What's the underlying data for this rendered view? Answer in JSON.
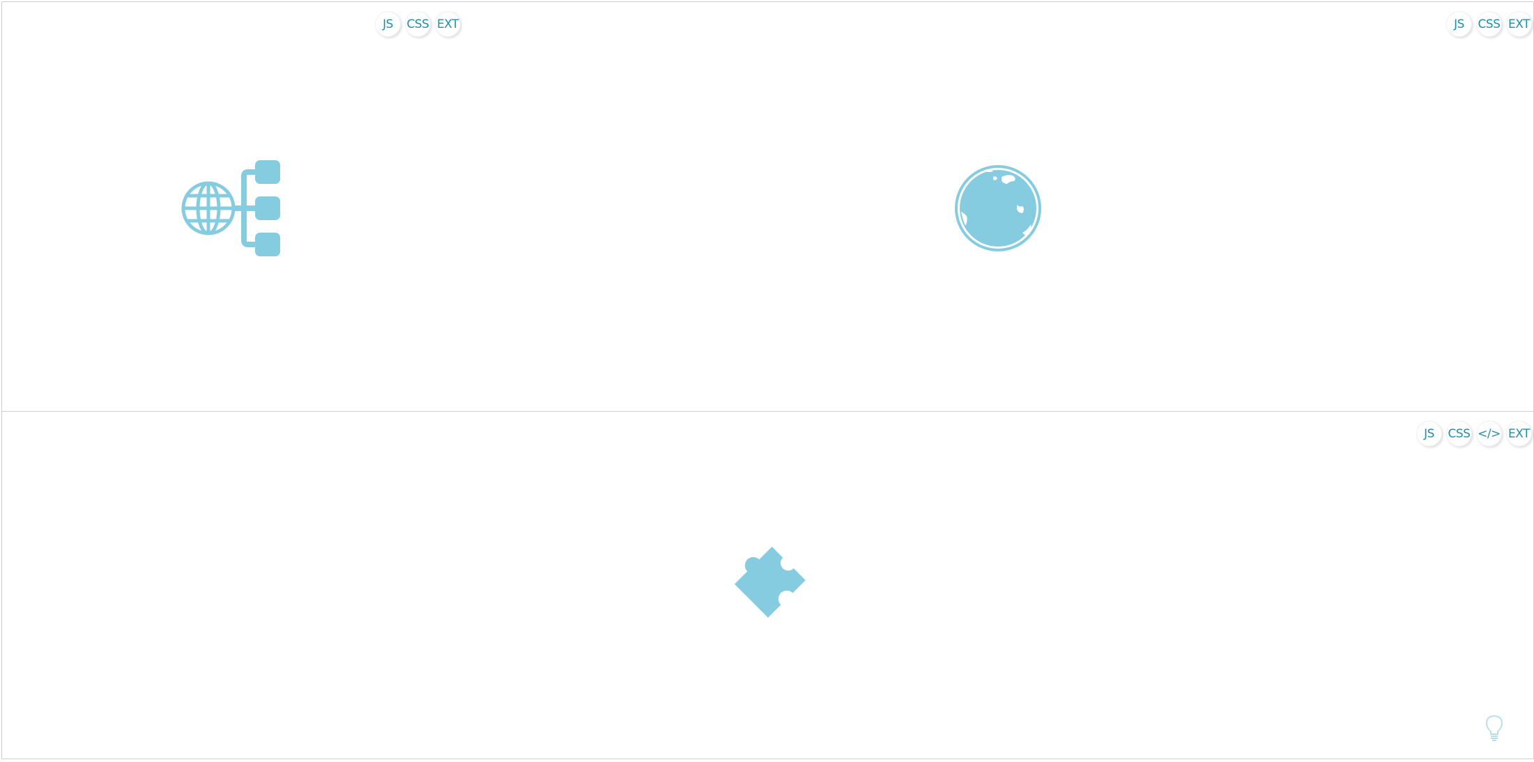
{
  "panels": {
    "top_left": {
      "tabs": [
        "JS",
        "CSS",
        "EXT"
      ],
      "icon": "sitemap-icon"
    },
    "top_right": {
      "tabs": [
        "JS",
        "CSS",
        "EXT"
      ],
      "icon": "globe-icon"
    },
    "bottom": {
      "tabs": [
        "JS",
        "CSS",
        "</>",
        "EXT"
      ],
      "icon": "puzzle-piece-icon",
      "corner_icon": "lightbulb-icon"
    }
  },
  "colors": {
    "icon": "#86cce0",
    "tab_text": "#1d8fae",
    "border": "#cfcfcf",
    "bulb": "#b9dfec"
  }
}
